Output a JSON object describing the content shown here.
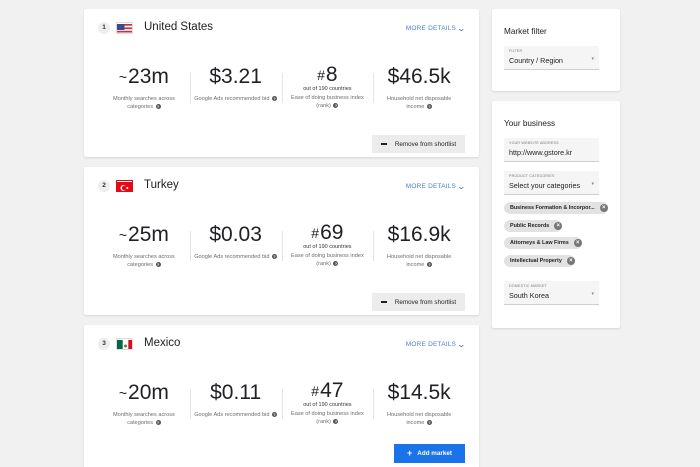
{
  "markets": [
    {
      "rank": "1",
      "country": "United States",
      "more_details": "MORE DETAILS",
      "searches": {
        "prefix": "~",
        "value": "23m",
        "label": "Monthly searches across categories"
      },
      "cpc": {
        "value": "$3.21",
        "label": "Google Ads recommended bid"
      },
      "ease": {
        "prefix": "#",
        "value": "8",
        "sub": "out of 190 countries",
        "label": "Ease of doing business index (rank)"
      },
      "income": {
        "value": "$46.5k",
        "label": "Household net disposable income"
      },
      "action": "Remove from shortlist"
    },
    {
      "rank": "2",
      "country": "Turkey",
      "more_details": "MORE DETAILS",
      "searches": {
        "prefix": "~",
        "value": "25m",
        "label": "Monthly searches across categories"
      },
      "cpc": {
        "value": "$0.03",
        "label": "Google Ads recommended bid"
      },
      "ease": {
        "prefix": "#",
        "value": "69",
        "sub": "out of 190 countries",
        "label": "Ease of doing business index (rank)"
      },
      "income": {
        "value": "$16.9k",
        "label": "Household net disposable income"
      },
      "action": "Remove from shortlist"
    },
    {
      "rank": "3",
      "country": "Mexico",
      "more_details": "MORE DETAILS",
      "searches": {
        "prefix": "~",
        "value": "20m",
        "label": "Monthly searches across categories"
      },
      "cpc": {
        "value": "$0.11",
        "label": "Google Ads recommended bid"
      },
      "ease": {
        "prefix": "#",
        "value": "47",
        "sub": "out of 190 countries",
        "label": "Ease of doing business index (rank)"
      },
      "income": {
        "value": "$14.5k",
        "label": "Household net disposable income"
      },
      "action": "Add market"
    }
  ],
  "market_filter": {
    "title": "Market filter",
    "filter_label": "FILTER",
    "filter_value": "Country / Region"
  },
  "business": {
    "title": "Your business",
    "website_label": "YOUR WEBSITE ADDRESS",
    "website_value": "http://www.gstore.kr",
    "categories_label": "PRODUCT CATEGORIES",
    "categories_placeholder": "Select your categories",
    "chips": [
      "Business Formation & Incorpor...",
      "Public Records",
      "Attorneys & Law Firms",
      "Intellectual Property"
    ],
    "domestic_label": "DOMESTIC MARKET",
    "domestic_value": "South Korea"
  },
  "colors": {
    "accent": "#1a73e8",
    "link": "#4a7fd4",
    "background": "#f1f1f1"
  }
}
